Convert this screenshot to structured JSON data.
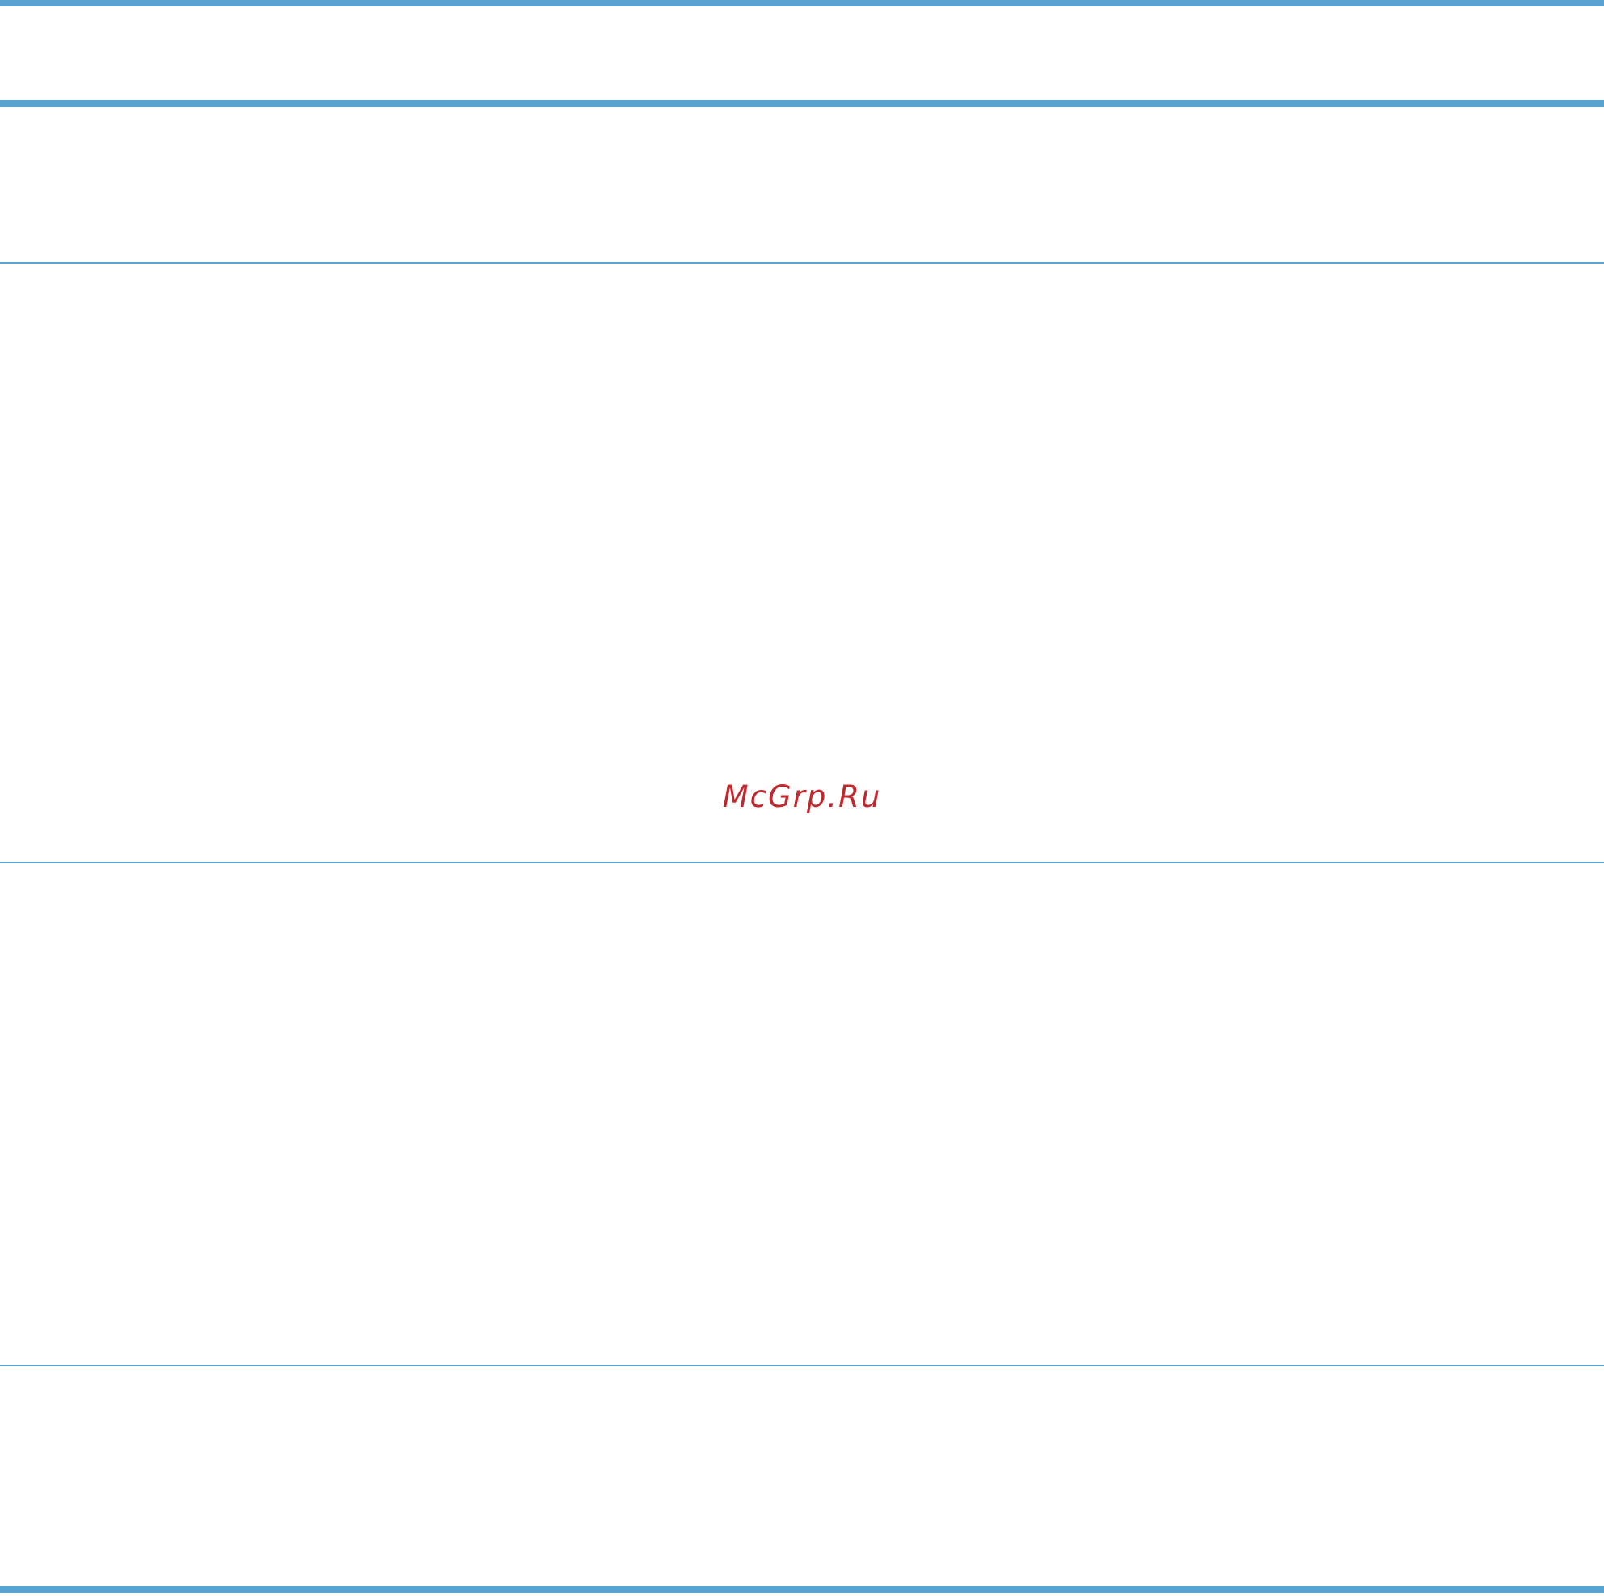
{
  "colors": {
    "rule": "#5aa2d2",
    "watermark": "#c1272d",
    "background": "#ffffff"
  },
  "watermark": {
    "text": "McGrp.Ru"
  },
  "table": {
    "rows": [
      {
        "cells": []
      },
      {
        "cells": []
      },
      {
        "cells": []
      },
      {
        "cells": []
      }
    ]
  }
}
